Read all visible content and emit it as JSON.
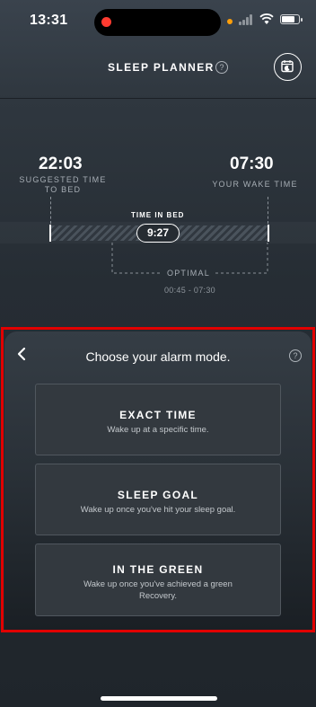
{
  "status_bar": {
    "time": "13:31"
  },
  "header": {
    "title": "SLEEP PLANNER",
    "help_glyph": "?"
  },
  "planner": {
    "suggested_time": "22:03",
    "suggested_caption_line1": "SUGGESTED TIME",
    "suggested_caption_line2": "TO BED",
    "wake_time": "07:30",
    "wake_caption": "YOUR WAKE TIME",
    "time_in_bed_label": "TIME IN BED",
    "time_in_bed": "9:27",
    "optimal_label": "OPTIMAL",
    "optimal_range": "00:45 - 07:30"
  },
  "alarm_sheet": {
    "title": "Choose your alarm mode.",
    "help_glyph": "?",
    "options": [
      {
        "title": "EXACT TIME",
        "subtitle": "Wake up at a specific time."
      },
      {
        "title": "SLEEP GOAL",
        "subtitle": "Wake up once you've hit your sleep goal."
      },
      {
        "title": "IN THE GREEN",
        "subtitle_line1": "Wake up once you've achieved a green",
        "subtitle_line2": "Recovery."
      }
    ]
  },
  "colors": {
    "highlight_box": "#e10000",
    "background": "#2c333b",
    "card": "#33393f"
  },
  "icons": [
    "back-chevron-icon",
    "calendar-icon",
    "help-icon",
    "wifi-icon",
    "battery-icon",
    "signal-icon"
  ]
}
